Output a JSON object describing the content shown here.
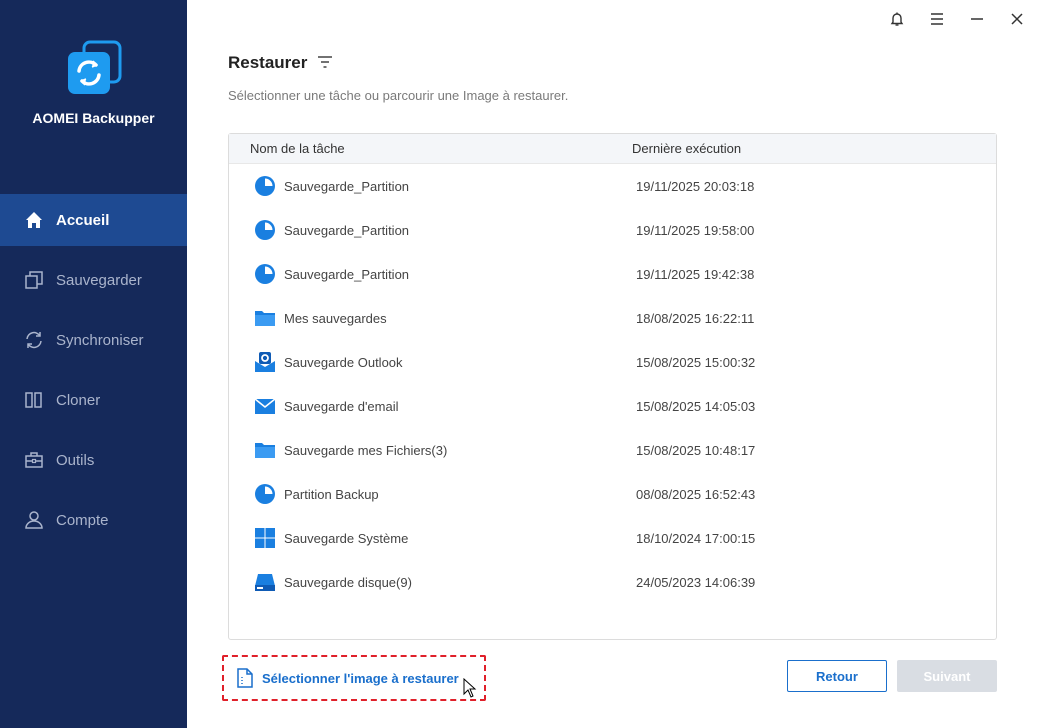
{
  "app": {
    "name": "AOMEI Backupper"
  },
  "sidebar": {
    "items": [
      {
        "label": "Accueil",
        "icon": "home-icon",
        "active": true
      },
      {
        "label": "Sauvegarder",
        "icon": "backup-icon",
        "active": false
      },
      {
        "label": "Synchroniser",
        "icon": "sync-icon",
        "active": false
      },
      {
        "label": "Cloner",
        "icon": "clone-icon",
        "active": false
      },
      {
        "label": "Outils",
        "icon": "toolbox-icon",
        "active": false
      },
      {
        "label": "Compte",
        "icon": "user-icon",
        "active": false
      }
    ]
  },
  "topbar": {
    "icons": [
      "bell-icon",
      "menu-icon",
      "minimize-icon",
      "close-icon"
    ]
  },
  "main": {
    "title": "Restaurer",
    "subtitle": "Sélectionner une tâche ou parcourir une Image à restaurer.",
    "columns": [
      "Nom de la tâche",
      "Dernière exécution"
    ],
    "rows": [
      {
        "icon": "partition-icon",
        "name": "Sauvegarde_Partition",
        "date": "19/11/2025 20:03:18"
      },
      {
        "icon": "partition-icon",
        "name": "Sauvegarde_Partition",
        "date": "19/11/2025 19:58:00"
      },
      {
        "icon": "partition-icon",
        "name": "Sauvegarde_Partition",
        "date": "19/11/2025 19:42:38"
      },
      {
        "icon": "folder-icon",
        "name": "Mes sauvegardes",
        "date": "18/08/2025 16:22:11"
      },
      {
        "icon": "outlook-icon",
        "name": "Sauvegarde Outlook",
        "date": "15/08/2025 15:00:32"
      },
      {
        "icon": "email-icon",
        "name": "Sauvegarde d'email",
        "date": "15/08/2025 14:05:03"
      },
      {
        "icon": "folder-icon",
        "name": "Sauvegarde mes Fichiers(3)",
        "date": "15/08/2025 10:48:17"
      },
      {
        "icon": "partition-icon",
        "name": "Partition Backup",
        "date": "08/08/2025 16:52:43"
      },
      {
        "icon": "windows-icon",
        "name": "Sauvegarde Système",
        "date": "18/10/2024 17:00:15"
      },
      {
        "icon": "disk-icon",
        "name": "Sauvegarde disque(9)",
        "date": "24/05/2023 14:06:39"
      }
    ]
  },
  "footer": {
    "select_image_label": "Sélectionner l'image à restaurer",
    "back_label": "Retour",
    "next_label": "Suivant"
  },
  "colors": {
    "sidebar_bg": "#15295a",
    "sidebar_active": "#1e4a92",
    "accent": "#1a6fcc",
    "highlight_border": "#e0202a"
  }
}
